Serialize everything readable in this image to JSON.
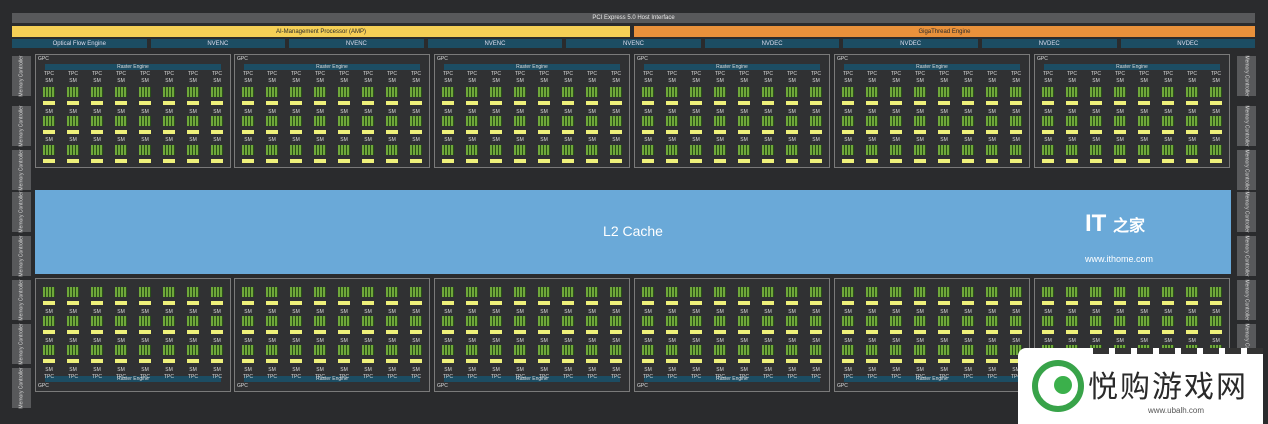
{
  "pcie": "PCI Express 5.0 Host Interface",
  "amp": "AI-Management Processor (AMP)",
  "giga": "GigaThread Engine",
  "engines": [
    "Optical Flow Engine",
    "NVENC",
    "NVENC",
    "NVENC",
    "NVENC",
    "NVDEC",
    "NVDEC",
    "NVDEC",
    "NVDEC"
  ],
  "memory_controller": "Memory Controller",
  "l2": "L2 Cache",
  "gpc_label": "GPC",
  "raster_label": "Raster Engine",
  "tpc_label": "TPC",
  "sm_label": "SM",
  "logo": {
    "it": "IT",
    "cn": "之家",
    "url": "www.ithome.com"
  },
  "watermark": {
    "title": "悦购游戏网",
    "url": "www.ubalh.com"
  },
  "colors": {
    "amp": "#f5cf56",
    "giga": "#e9913b",
    "l2": "#6aa9d8",
    "engine": "#1c4d63"
  }
}
